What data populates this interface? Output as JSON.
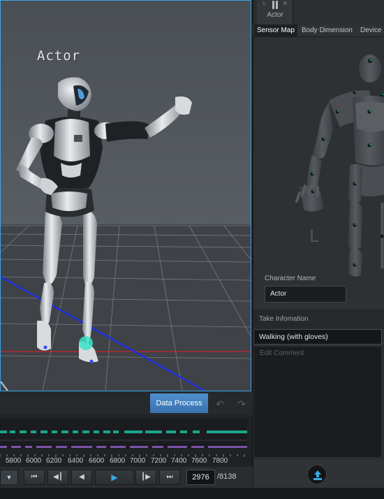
{
  "viewport": {
    "actor_label": "Actor"
  },
  "toolbar": {
    "data_process_label": "Data Process",
    "undo_icon": "undo-icon",
    "redo_icon": "redo-icon"
  },
  "timeline": {
    "ticks": [
      "5800",
      "6000",
      "6200",
      "6400",
      "6600",
      "6800",
      "7000",
      "7200",
      "7400",
      "7600",
      "7800"
    ]
  },
  "transport": {
    "current_frame": "2976",
    "total_frames": "/8138"
  },
  "right_panel": {
    "actor_tab": {
      "label": "Actor",
      "left": "L",
      "right": "R"
    },
    "tabs": [
      "Sensor Map",
      "Body Dimension",
      "Device"
    ],
    "active_tab": "Sensor Map",
    "hand_label": "L",
    "character_name_label": "Character Name",
    "character_name": "Actor",
    "take_info_label": "Take Infomation",
    "take_name": "Walking (with gloves)",
    "comment_placeholder": "Edit Comment"
  },
  "colors": {
    "accent": "#3aa7e6",
    "button": "#3f7fbe",
    "timeline_green": "#1aa68a",
    "timeline_purple": "#8a5db3"
  }
}
